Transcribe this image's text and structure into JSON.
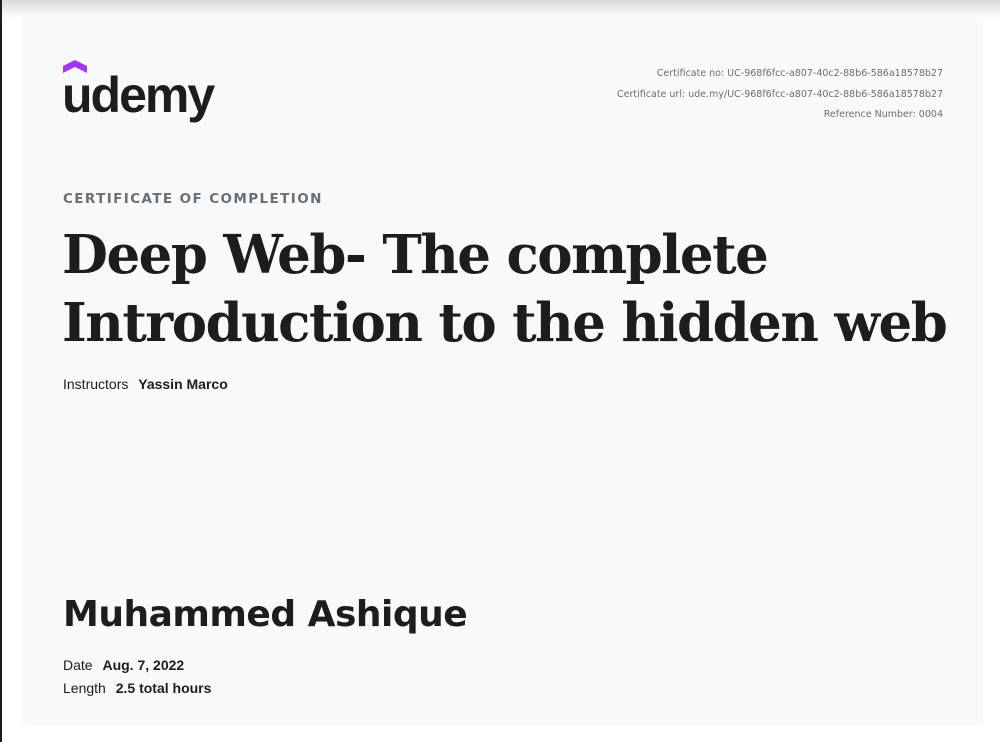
{
  "logo": {
    "text": "udemy",
    "accent_color": "#a435f0"
  },
  "meta": {
    "certificate_no": "Certificate no: UC-968f6fcc-a807-40c2-88b6-586a18578b27",
    "certificate_url": "Certificate url: ude.my/UC-968f6fcc-a807-40c2-88b6-586a18578b27",
    "reference_number": "Reference Number: 0004"
  },
  "certificate": {
    "eyebrow": "CERTIFICATE OF COMPLETION",
    "title_line1": "Deep Web- The complete",
    "title_line2": "Introduction to the hidden web",
    "instructors_label": "Instructors",
    "instructor_name": "Yassin Marco",
    "student_name": "Muhammed Ashique",
    "date_label": "Date",
    "date_value": "Aug. 7, 2022",
    "length_label": "Length",
    "length_value": "2.5 total hours"
  }
}
